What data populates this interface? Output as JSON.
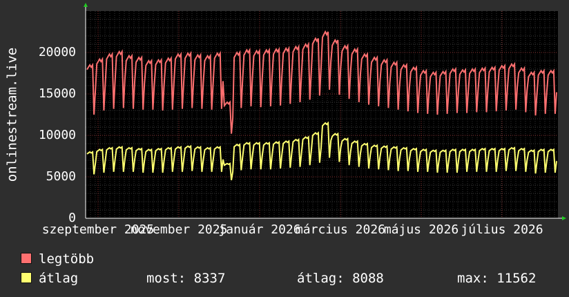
{
  "chart_data": {
    "type": "line",
    "ylabel": "onlinestream.live",
    "ylim": [
      0,
      25000
    ],
    "y_ticks": [
      0,
      5000,
      10000,
      15000,
      20000
    ],
    "x_tick_labels": [
      "szeptember 2025",
      "november 2025",
      "január 2026",
      "március 2026",
      "május 2026",
      "július 2026"
    ],
    "grid": true,
    "background": "#000000",
    "series": [
      {
        "name": "legtöbb",
        "color": "#ff7070",
        "weekly_peaks": [
          18500,
          19200,
          19800,
          20100,
          19600,
          19400,
          19000,
          19100,
          19300,
          19800,
          19900,
          19700,
          19600,
          19900,
          14000,
          20000,
          20300,
          20200,
          20300,
          20400,
          20500,
          20700,
          21000,
          21700,
          22500,
          21500,
          20800,
          20400,
          19800,
          19400,
          19100,
          18800,
          18500,
          18200,
          17800,
          17600,
          17700,
          18000,
          17900,
          18000,
          18100,
          18200,
          18400,
          18600,
          18100,
          17600,
          17800,
          17800
        ],
        "weekly_troughs": [
          12500,
          13000,
          13200,
          13300,
          13200,
          13100,
          13100,
          13000,
          13100,
          13200,
          13300,
          13200,
          13100,
          13200,
          10200,
          13300,
          13500,
          13400,
          13500,
          13600,
          13800,
          14000,
          14300,
          14800,
          15500,
          14900,
          14400,
          14000,
          13700,
          13500,
          13300,
          13100,
          12900,
          12700,
          12600,
          12500,
          12600,
          12700,
          12700,
          12800,
          12800,
          12900,
          13000,
          13100,
          12800,
          12400,
          12600,
          12600
        ]
      },
      {
        "name": "átlag",
        "color": "#ffff70",
        "weekly_peaks": [
          8000,
          8300,
          8500,
          8600,
          8500,
          8400,
          8300,
          8400,
          8500,
          8600,
          8700,
          8600,
          8500,
          8600,
          6600,
          8900,
          9100,
          9100,
          9100,
          9200,
          9300,
          9500,
          9800,
          10300,
          11500,
          10200,
          9600,
          9300,
          9000,
          8800,
          8700,
          8600,
          8500,
          8400,
          8300,
          8200,
          8200,
          8300,
          8300,
          8300,
          8400,
          8400,
          8400,
          8500,
          8400,
          8200,
          8300,
          8300
        ],
        "weekly_troughs": [
          5300,
          5500,
          5600,
          5600,
          5600,
          5500,
          5500,
          5500,
          5600,
          5600,
          5700,
          5600,
          5600,
          5600,
          4600,
          5800,
          5900,
          5900,
          5900,
          6000,
          6100,
          6200,
          6400,
          6700,
          7300,
          6800,
          6400,
          6200,
          6000,
          5900,
          5800,
          5700,
          5700,
          5600,
          5600,
          5500,
          5500,
          5500,
          5600,
          5600,
          5600,
          5600,
          5700,
          5700,
          5600,
          5400,
          5500,
          5500
        ]
      }
    ]
  },
  "legend": {
    "max_label": "legtöbb",
    "avg_label": "átlag",
    "max_color": "#ff7070",
    "avg_color": "#ffff70",
    "stat_now": "most: 8337",
    "stat_avg": "átlag: 8088",
    "stat_max": "max: 11562"
  }
}
